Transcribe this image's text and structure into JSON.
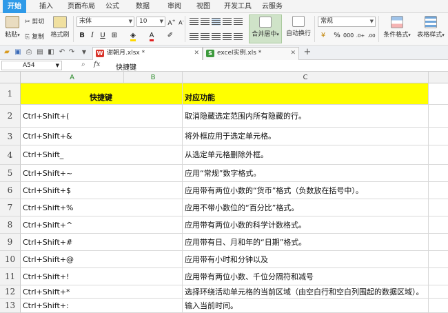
{
  "menu": {
    "tabs": [
      "开始",
      "插入",
      "页面布局",
      "公式",
      "数据",
      "审阅",
      "视图",
      "开发工具",
      "云服务"
    ],
    "active_index": 0
  },
  "ribbon": {
    "paste_label": "粘贴",
    "cut_label": "剪切",
    "copy_label": "复制",
    "format_painter_label": "格式刷",
    "font_name": "宋体",
    "font_size": "10",
    "merge_center_label": "合并居中",
    "wrap_text_label": "自动换行",
    "number_format": "常规",
    "percent_symbol": "%",
    "conditional_format_label": "条件格式",
    "table_style_label": "表格样式",
    "accent_color": "#2f9ae8",
    "merge_highlight_color": "#cfe3c8"
  },
  "tabs": {
    "items": [
      {
        "label": "谢朝月.xlsx *",
        "active": true
      },
      {
        "label": "excel实例.xls *",
        "active": false
      }
    ],
    "add_label": "+"
  },
  "formula_bar": {
    "cell_ref": "A54",
    "fx_label": "fx",
    "content": "快捷键"
  },
  "columns": [
    "A",
    "B",
    "C"
  ],
  "rows": [
    {
      "num": "1",
      "shortcut": "快捷键",
      "description": "对应功能"
    },
    {
      "num": "2",
      "shortcut": "Ctrl+Shift+(",
      "description": "取消隐藏选定范围内所有隐藏的行。"
    },
    {
      "num": "3",
      "shortcut": "Ctrl+Shift+&",
      "description": "将外框应用于选定单元格。"
    },
    {
      "num": "4",
      "shortcut": "Ctrl+Shift_",
      "description": "从选定单元格删除外框。"
    },
    {
      "num": "5",
      "shortcut": "Ctrl+Shift+~",
      "description": "应用“常规”数字格式。"
    },
    {
      "num": "6",
      "shortcut": "Ctrl+Shift+$",
      "description": "应用带有两位小数的“货币”格式（负数放在括号中）。"
    },
    {
      "num": "7",
      "shortcut": "Ctrl+Shift+%",
      "description": "应用不带小数位的“百分比”格式。"
    },
    {
      "num": "8",
      "shortcut": "Ctrl+Shift+^",
      "description": "应用带有两位小数的科学计数格式。"
    },
    {
      "num": "9",
      "shortcut": "Ctrl+Shift+#",
      "description": "应用带有日、月和年的“日期”格式。"
    },
    {
      "num": "10",
      "shortcut": "Ctrl+Shift+@",
      "description": "应用带有小时和分钟以及"
    },
    {
      "num": "11",
      "shortcut": "Ctrl+Shift+!",
      "description": "应用带有两位小数、千位分隔符和减号"
    },
    {
      "num": "12",
      "shortcut": "Ctrl+Shift+*",
      "description": "选择环绕活动单元格的当前区域（由空白行和空白列围起的数据区域）。"
    },
    {
      "num": "13",
      "shortcut": "Ctrl+Shift+:",
      "description": "输入当前时间。"
    }
  ],
  "header_fill_color": "#ffff00"
}
